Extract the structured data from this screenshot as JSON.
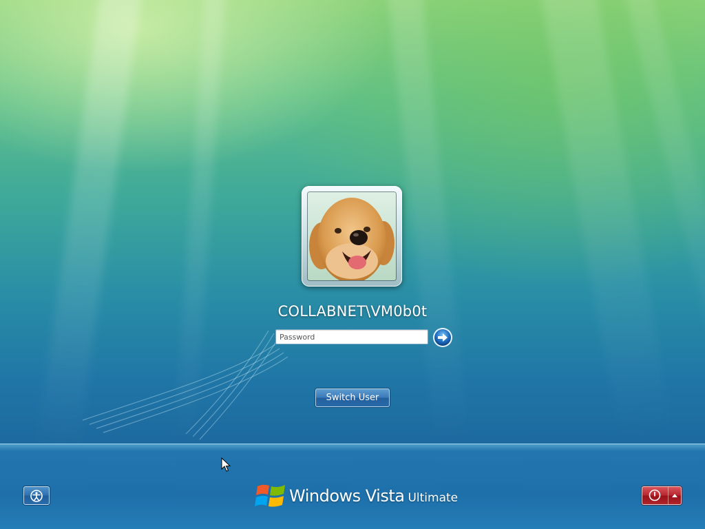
{
  "logon": {
    "username": "COLLABNET\\VM0b0t",
    "password_placeholder": "Password",
    "password_value": ""
  },
  "buttons": {
    "switch_user_label": "Switch User"
  },
  "branding": {
    "brand": "Windows Vista",
    "edition": "Ultimate"
  },
  "icons": {
    "user_picture": "golden-retriever-puppy",
    "submit": "arrow-right-icon",
    "ease_of_access": "ease-of-access-icon",
    "shutdown": "power-icon",
    "shutdown_options": "triangle-up-icon"
  },
  "colors": {
    "background_top": "#8ed37d",
    "background_bottom": "#1d6aa0",
    "switch_user_button": "#3a79b8",
    "power_button": "#b5262e"
  }
}
